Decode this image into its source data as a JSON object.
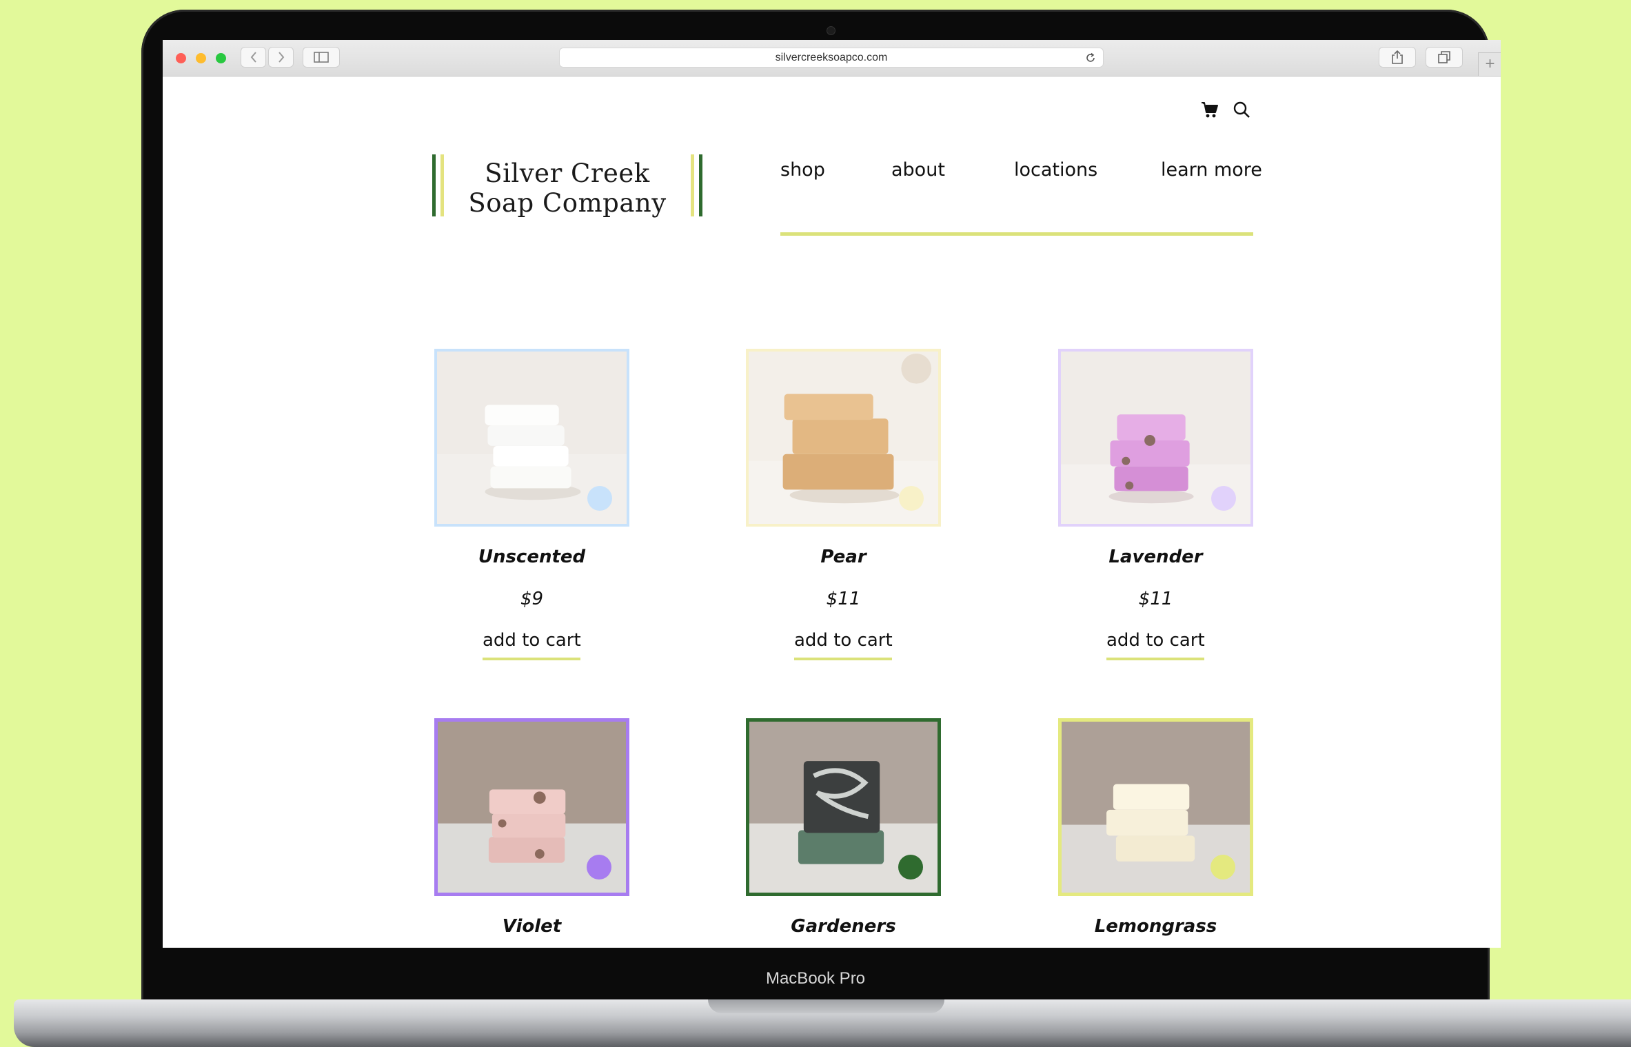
{
  "browser": {
    "url": "silvercreeksoapco.com"
  },
  "device": {
    "label": "MacBook Pro"
  },
  "header": {
    "logo_line1": "Silver Creek",
    "logo_line2": "Soap Company",
    "nav": [
      "shop",
      "about",
      "locations",
      "learn more"
    ]
  },
  "colors": {
    "accent_yellow": "#dbe27a",
    "logo_green": "#2f6b2f",
    "logo_yellow": "#e4e37f"
  },
  "products": [
    {
      "name": "Unscented",
      "price": "$9",
      "button": "add to cart",
      "accent": "#c8e2fb",
      "dot": "#c8e2fb"
    },
    {
      "name": "Pear",
      "price": "$11",
      "button": "add to cart",
      "accent": "#f8f1c8",
      "dot": "#f8f1c8"
    },
    {
      "name": "Lavender",
      "price": "$11",
      "button": "add to cart",
      "accent": "#e1d2fb",
      "dot": "#e1d2fb"
    },
    {
      "name": "Violet",
      "price": "",
      "button": "",
      "accent": "#a77cf0",
      "dot": "#a77cf0"
    },
    {
      "name": "Gardeners",
      "price": "",
      "button": "",
      "accent": "#2f6b2f",
      "dot": "#2f6b2f"
    },
    {
      "name": "Lemongrass",
      "price": "",
      "button": "",
      "accent": "#e4e97f",
      "dot": "#e4e97f"
    }
  ]
}
